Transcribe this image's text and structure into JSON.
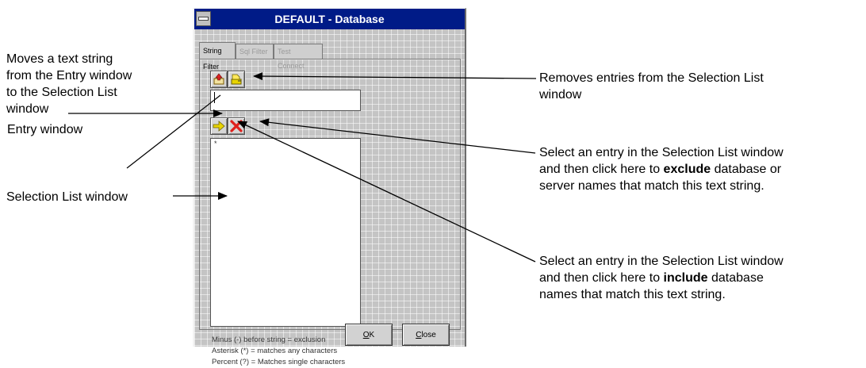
{
  "window": {
    "title": "DEFAULT - Database"
  },
  "tabs": [
    {
      "label": "String Filter",
      "active": true
    },
    {
      "label": "Sql Filter",
      "active": false
    },
    {
      "label": "Test Connect",
      "active": false
    }
  ],
  "entry_field": {
    "value": ""
  },
  "selection_list": {
    "items": [
      "*"
    ]
  },
  "legend": [
    "Minus (-) before string = exclusion",
    "Asterisk (*) = matches any characters",
    "Percent  (?) = Matches single characters"
  ],
  "buttons": {
    "ok": {
      "mnemonic": "O",
      "rest": "K"
    },
    "close": {
      "mnemonic": "C",
      "rest": "lose"
    }
  },
  "annotations": {
    "move_text_lines": [
      "Moves a text string",
      "from the Entry window",
      "to the Selection List",
      "window"
    ],
    "entry_window": "Entry window",
    "selection_list_window": "Selection List window",
    "removes_entries_lines": [
      "Removes entries from the Selection List",
      "window"
    ],
    "exclude": {
      "line1": "Select an entry in the Selection List window",
      "line2_pre": "and then click here to ",
      "line2_bold": "exclude",
      "line2_post": " database or",
      "line3": "server names that match this text string."
    },
    "include": {
      "line1": "Select an entry in the Selection List window",
      "line2_pre": "and then click here to ",
      "line2_bold": "include",
      "line2_post": " database",
      "line3": "names that match this text string."
    }
  },
  "icons": {
    "system_menu": "system-menu-icon",
    "add_to_list": "add-to-list-icon",
    "remove_entries": "remove-entries-icon",
    "include": "arrow-right-icon",
    "exclude": "red-x-icon"
  },
  "colors": {
    "titlebar": "#001b87",
    "dialog_bg": "#c4c4c4",
    "exclude_x": "#e0201c",
    "include_arrow": "#e8d400"
  }
}
